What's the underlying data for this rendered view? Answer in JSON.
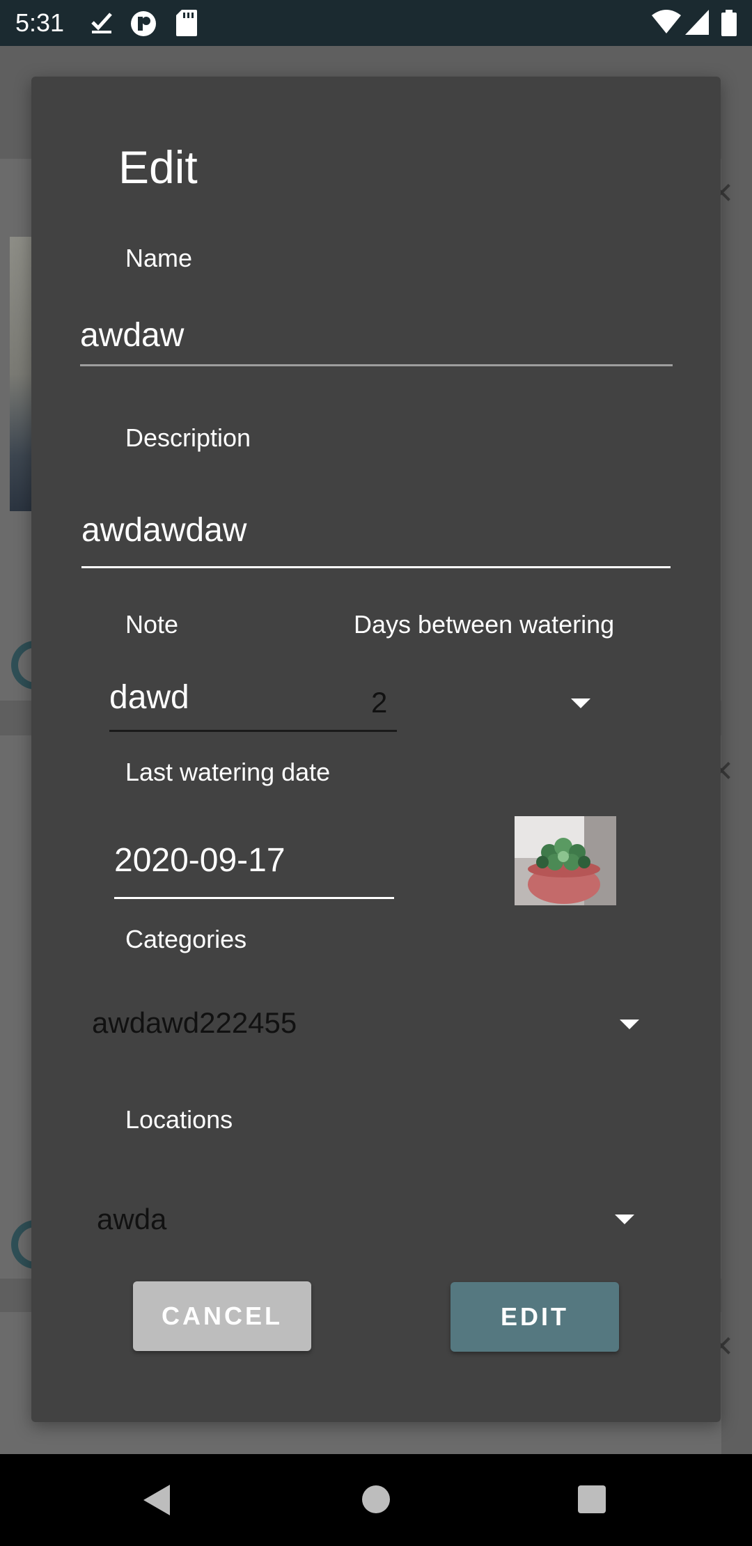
{
  "status_bar": {
    "time": "5:31",
    "left_icons": [
      "download-done-icon",
      "podcast-icon",
      "sd-card-icon"
    ],
    "right_icons": [
      "wifi-icon",
      "signal-icon",
      "battery-icon"
    ]
  },
  "dialog": {
    "title": "Edit",
    "name": {
      "label": "Name",
      "value": "awdaw"
    },
    "description": {
      "label": "Description",
      "value": "awdawdaw"
    },
    "note": {
      "label": "Note",
      "value": "dawd"
    },
    "days_between_watering": {
      "label": "Days between watering",
      "value": "2"
    },
    "last_watering_date": {
      "label": "Last watering date",
      "value": "2020-09-17"
    },
    "photo": {
      "icon": "succulent-plant-photo"
    },
    "categories": {
      "label": "Categories",
      "selected": "awdawd222455"
    },
    "locations": {
      "label": "Locations",
      "selected": "awda"
    },
    "buttons": {
      "cancel": "CANCEL",
      "edit": "EDIT"
    }
  },
  "colors": {
    "dialog_bg": "#424242",
    "edit_button": "#557880",
    "cancel_button": "#bdbdbd",
    "status_bar": "#1b2a30"
  },
  "nav_bar": {
    "icons": [
      "back-icon",
      "home-icon",
      "recents-icon"
    ]
  }
}
